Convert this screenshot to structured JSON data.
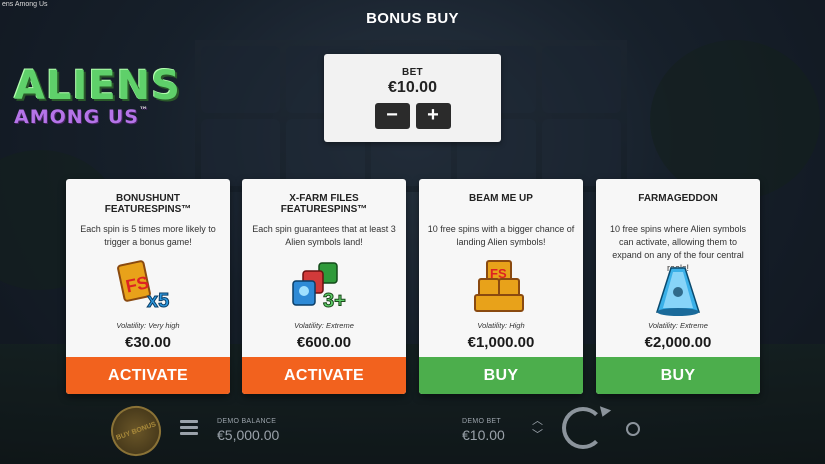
{
  "window": {
    "title": "ens Among Us"
  },
  "logo": {
    "line1": "ALIENS",
    "line2": "AMONG US",
    "tm": "™"
  },
  "header": {
    "title": "BONUS BUY"
  },
  "bet": {
    "label": "BET",
    "value": "€10.00",
    "minus": "−",
    "plus": "+"
  },
  "cards": [
    {
      "title": "BONUSHUNT FEATURESPINS™",
      "description": "Each spin is 5 times more likely to trigger a bonus game!",
      "icon": "fs-x5-icon",
      "icon_text": "x5",
      "volatility": "Volatility: Very high",
      "price": "€30.00",
      "action": "ACTIVATE",
      "action_color": "#f2621e"
    },
    {
      "title": "X-FARM FILES FEATURESPINS™",
      "description": "Each spin guarantees that at least 3 Alien symbols land!",
      "icon": "aliens-3plus-icon",
      "icon_text": "3+",
      "volatility": "Volatility: Extreme",
      "price": "€600.00",
      "action": "ACTIVATE",
      "action_color": "#f2621e"
    },
    {
      "title": "BEAM ME UP",
      "description": "10 free spins with a bigger chance of landing Alien symbols!",
      "icon": "fs-stack-icon",
      "icon_text": "FS",
      "volatility": "Volatility: High",
      "price": "€1,000.00",
      "action": "BUY",
      "action_color": "#4cae4c"
    },
    {
      "title": "FARMAGEDDON",
      "description": "10 free spins where Alien symbols can activate, allowing them to expand on any of the four central reels!",
      "icon": "beam-icon",
      "icon_text": "",
      "volatility": "Volatility: Extreme",
      "price": "€2,000.00",
      "action": "BUY",
      "action_color": "#4cae4c"
    }
  ],
  "bottom": {
    "buy_bonus": "BUY BONUS",
    "balance_label": "DEMO BALANCE",
    "balance_value": "€5,000.00",
    "demo_bet_label": "DEMO BET",
    "demo_bet_value": "€10.00"
  }
}
